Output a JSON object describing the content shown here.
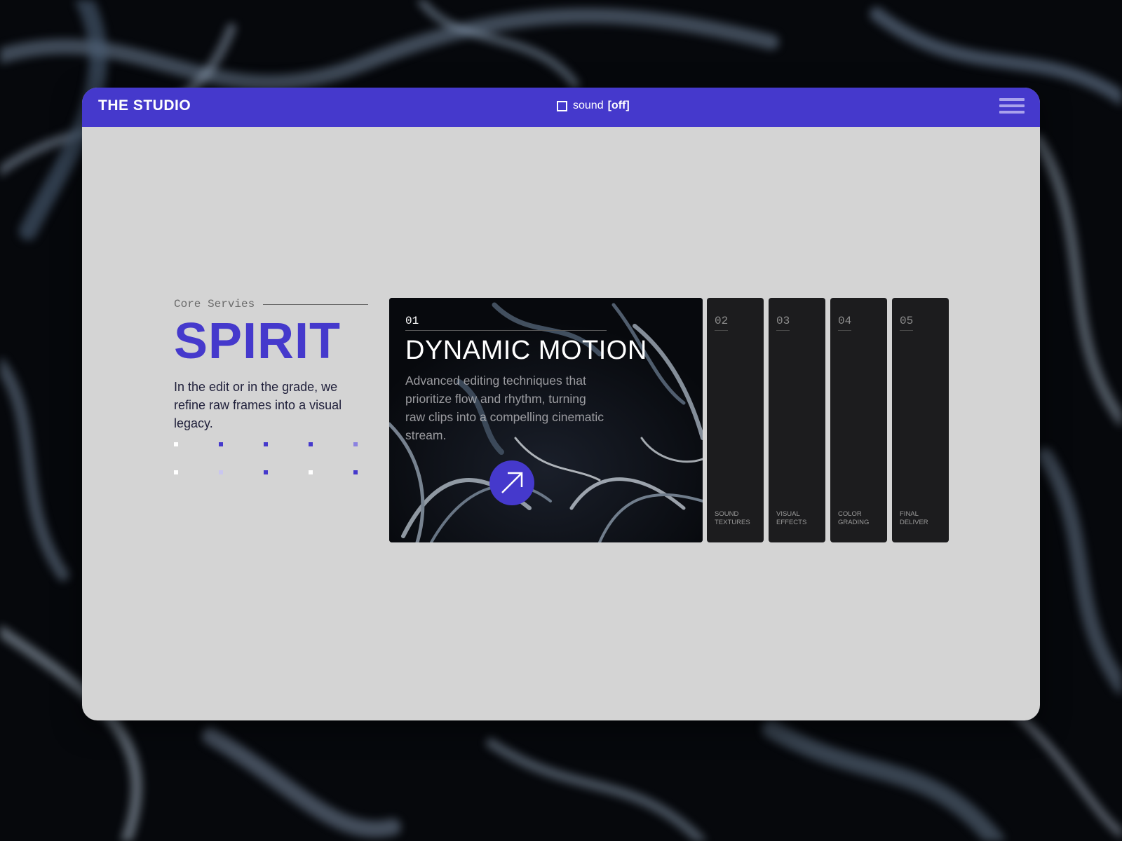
{
  "header": {
    "brand": "THE STUDIO",
    "sound_label": "sound",
    "sound_state": "[off]",
    "menu_icon": "hamburger-menu-icon"
  },
  "intro": {
    "eyebrow": "Core Servies",
    "headline": "SPIRIT",
    "lead": "In the edit or in the grade, we refine raw frames into a visual legacy."
  },
  "featured": {
    "number": "01",
    "title": "DYNAMIC MOTION",
    "description": "Advanced editing techniques that prioritize flow and rhythm, turning raw clips into a compelling cinematic stream.",
    "action_icon": "arrow-up-right-icon"
  },
  "services": [
    {
      "number": "02",
      "label": "SOUND TEXTURES"
    },
    {
      "number": "03",
      "label": "VISUAL EFFECTS"
    },
    {
      "number": "04",
      "label": "COLOR GRADING"
    },
    {
      "number": "05",
      "label": "FINAL DELIVER"
    }
  ],
  "colors": {
    "accent": "#4539cc",
    "panel": "#d4d4d4",
    "card": "#1c1c1e"
  }
}
